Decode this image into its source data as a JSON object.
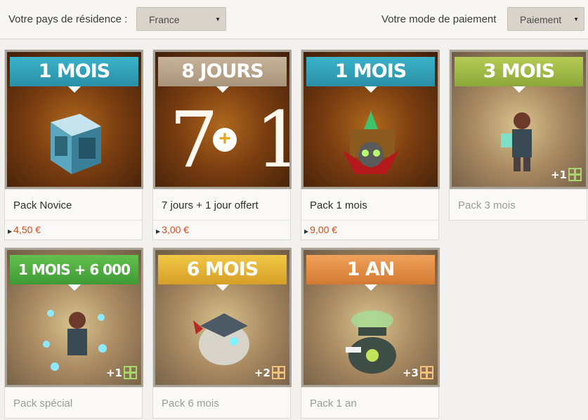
{
  "header": {
    "country_label": "Votre pays de résidence :",
    "country_value": "France",
    "payment_label": "Votre mode de paiement",
    "payment_value": "Paiement"
  },
  "cards": [
    {
      "banner": "1 MOIS",
      "name": "Pack Novice",
      "price": "4,50 €",
      "bonus": ""
    },
    {
      "banner": "8 JOURS",
      "name": "7 jours + 1 jour offert",
      "price": "3,00 €",
      "bonus": "",
      "big_left": "7",
      "big_right": "1"
    },
    {
      "banner": "1 MOIS",
      "name": "Pack 1 mois",
      "price": "9,00 €",
      "bonus": ""
    },
    {
      "banner": "3 MOIS",
      "name": "Pack 3 mois",
      "price": "",
      "bonus": "+1"
    },
    {
      "banner": "1 MOIS + 6 000",
      "name": "Pack spécial",
      "price": "",
      "bonus": "+1"
    },
    {
      "banner": "6 MOIS",
      "name": "Pack 6 mois",
      "price": "",
      "bonus": "+2"
    },
    {
      "banner": "1 AN",
      "name": "Pack 1 an",
      "price": "",
      "bonus": "+3"
    }
  ],
  "colors": {
    "price": "#d24d1b",
    "accent_blue": "#2c8fa6"
  }
}
